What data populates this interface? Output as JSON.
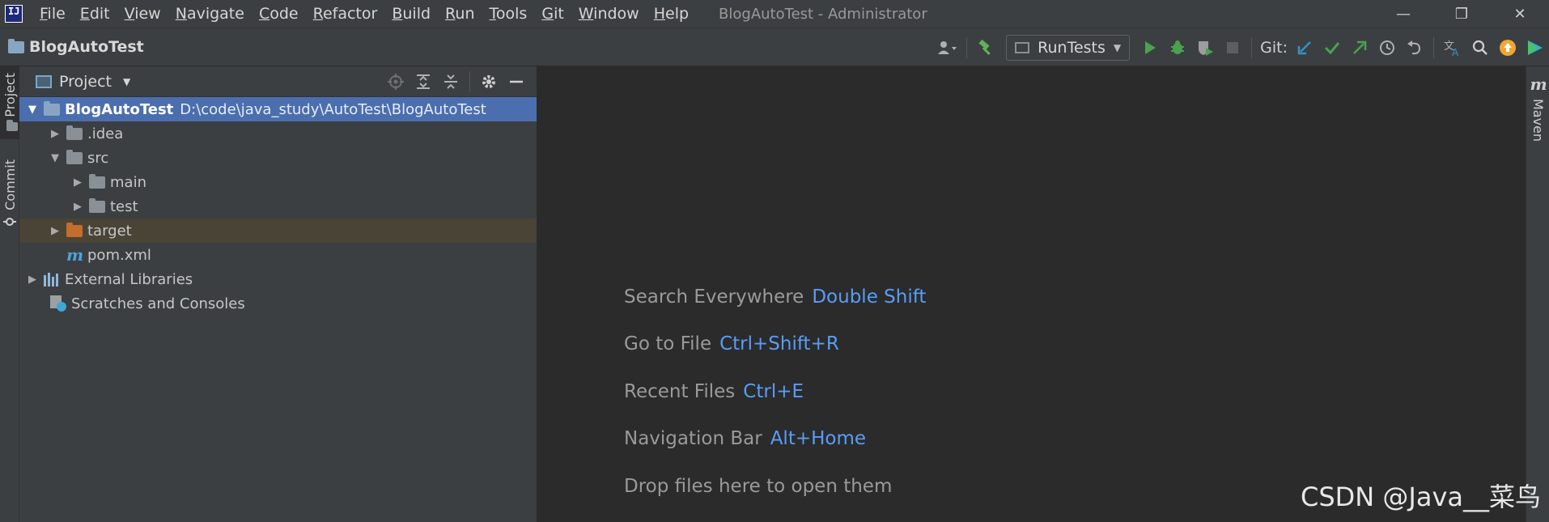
{
  "titlebar": {
    "menu": [
      "File",
      "Edit",
      "View",
      "Navigate",
      "Code",
      "Refactor",
      "Build",
      "Run",
      "Tools",
      "Git",
      "Window",
      "Help"
    ],
    "window_title": "BlogAutoTest - Administrator",
    "controls": {
      "minimize": "—",
      "restore": "❐",
      "close": "✕"
    }
  },
  "navbar": {
    "project_name": "BlogAutoTest",
    "run_config": "RunTests",
    "git_label": "Git:",
    "icons": [
      "user-icon",
      "build-hammer-icon",
      "run-icon",
      "debug-icon",
      "coverage-icon",
      "stop-icon",
      "git-update-icon",
      "git-commit-icon",
      "git-push-icon",
      "history-icon",
      "rollback-icon",
      "translate-icon",
      "search-icon",
      "update-icon",
      "toolbox-icon"
    ]
  },
  "left_stripe": {
    "project_tab": "Project",
    "commit_tab": "Commit"
  },
  "project_panel": {
    "title": "Project",
    "tree": {
      "root_name": "BlogAutoTest",
      "root_path": "D:\\code\\java_study\\AutoTest\\BlogAutoTest",
      "idea": ".idea",
      "src": "src",
      "main": "main",
      "test": "test",
      "target": "target",
      "pom": "pom.xml",
      "external_libraries": "External Libraries",
      "scratches": "Scratches and Consoles"
    }
  },
  "editor": {
    "hints": [
      {
        "label": "Search Everywhere",
        "key": "Double Shift"
      },
      {
        "label": "Go to File",
        "key": "Ctrl+Shift+R"
      },
      {
        "label": "Recent Files",
        "key": "Ctrl+E"
      },
      {
        "label": "Navigation Bar",
        "key": "Alt+Home"
      }
    ],
    "drop_text": "Drop files here to open them"
  },
  "right_stripe": {
    "maven_icon": "m",
    "maven_tab": "Maven"
  },
  "watermark": "CSDN @Java__菜鸟",
  "colors": {
    "selection": "#4b6eaf",
    "shortcut": "#589df6",
    "excluded_row": "#4a4436",
    "target_folder": "#c46d2f"
  }
}
